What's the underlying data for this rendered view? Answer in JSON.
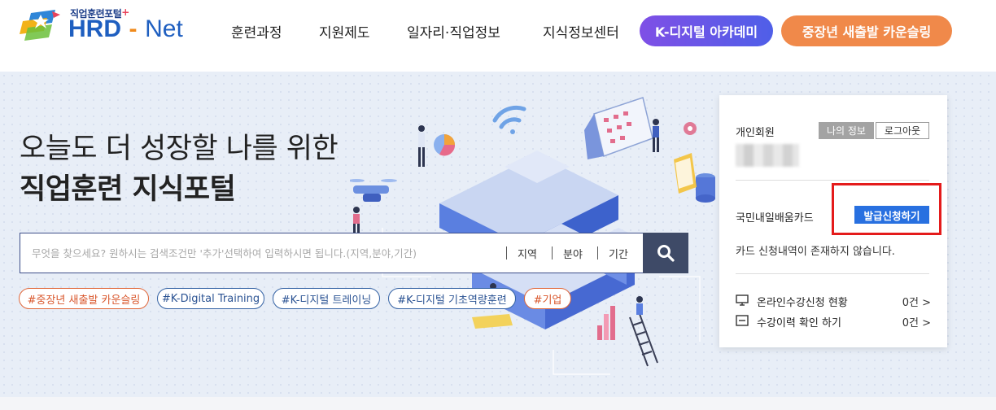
{
  "header": {
    "logo_sub": "직업훈련포털",
    "logo_plus": "+",
    "logo_hrd": "HRD",
    "logo_dash": "-",
    "logo_net": "Net",
    "nav": [
      "훈련과정",
      "지원제도",
      "일자리·직업정보",
      "지식정보센터"
    ],
    "pill_kdigital": "K-디지털 아카데미",
    "pill_counseling": "중장년 새출발 카운슬링"
  },
  "hero": {
    "title_line1": "오늘도 더 성장할 나를 위한",
    "title_line2": "직업훈련 지식포털"
  },
  "search": {
    "placeholder": "무엇을 찾으세요? 원하시는 검색조건만 '추가'선택하여 입력하시면 됩니다.(지역,분야,기간)",
    "value": "",
    "filters": [
      "지역",
      "분야",
      "기간"
    ]
  },
  "tags": [
    "#중장년 새출발 카운슬링",
    "#K-Digital Training",
    "#K-디지털 트레이닝",
    "#K-디지털 기초역량훈련",
    "#기업"
  ],
  "panel": {
    "member_type": "개인회원",
    "my_info": "나의 정보",
    "logout": "로그아웃",
    "card_label": "국민내일배움카드",
    "apply_button": "발급신청하기",
    "no_card_message": "카드 신청내역이 존재하지 않습니다.",
    "rows": [
      {
        "label": "온라인수강신청 현황",
        "count": "0건 >",
        "icon": "monitor-icon"
      },
      {
        "label": "수강이력 확인 하기",
        "count": "0건 >",
        "icon": "list-icon"
      }
    ]
  },
  "colors": {
    "brand_blue": "#1f5fc0",
    "search_button": "#3e4a67",
    "apply_button": "#2870e0",
    "highlight_red": "#e41b1b",
    "counseling_orange": "#f0894a"
  }
}
